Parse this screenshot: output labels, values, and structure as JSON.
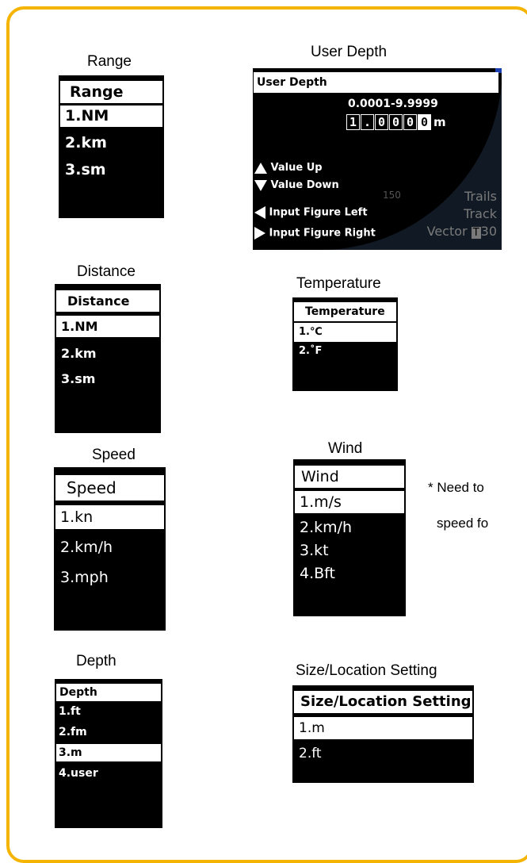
{
  "colors": {
    "frame": "#f5b400",
    "panel_bg": "#000000",
    "highlight": "#ffffff",
    "dim_text": "#777777"
  },
  "range": {
    "caption": "Range",
    "title": "Range",
    "items": [
      "1.NM",
      "2.km",
      "3.sm"
    ],
    "selected_index": 0
  },
  "user_depth": {
    "caption": "User Depth",
    "title": "User Depth",
    "range_text": "0.0001-9.9999",
    "digits": [
      "1",
      ".",
      "0",
      "0",
      "0",
      "0"
    ],
    "cursor_index": 5,
    "unit": "m",
    "hints": [
      {
        "icon": "triangle-up-icon",
        "label": "Value Up"
      },
      {
        "icon": "triangle-down-icon",
        "label": "Value Down"
      },
      {
        "icon": "triangle-left-icon",
        "label": "Input Figure Left"
      },
      {
        "icon": "triangle-right-icon",
        "label": "Input Figure Right"
      }
    ],
    "scale_label": "150",
    "right_labels": {
      "trails": "Trails",
      "track": "Track",
      "vector": "Vector",
      "vector_badge": "T",
      "vector_value": "30"
    }
  },
  "distance": {
    "caption": "Distance",
    "title": "Distance",
    "items": [
      "1.NM",
      "2.km",
      "3.sm"
    ],
    "selected_index": 0
  },
  "temperature": {
    "caption": "Temperature",
    "title": "Temperature",
    "items": [
      "1.℃",
      "2.˚F"
    ],
    "selected_index": 0
  },
  "speed": {
    "caption": "Speed",
    "title": "Speed",
    "items": [
      "1.kn",
      "2.km/h",
      "3.mph"
    ],
    "selected_index": 0
  },
  "wind": {
    "caption": "Wind",
    "title": "Wind",
    "items": [
      "1.m/s",
      "2.km/h",
      "3.kt",
      "4.Bft"
    ],
    "selected_index": 0
  },
  "note": {
    "line1": "* Need to",
    "line2": "speed fo"
  },
  "depth": {
    "caption": "Depth",
    "title": "Depth",
    "items": [
      "1.ft",
      "2.fm",
      "3.m",
      "4.user"
    ],
    "selected_index": 2
  },
  "size_location": {
    "caption": "Size/Location Setting",
    "title": "Size/Location Setting",
    "items": [
      "1.m",
      "2.ft"
    ],
    "selected_index": 0
  }
}
